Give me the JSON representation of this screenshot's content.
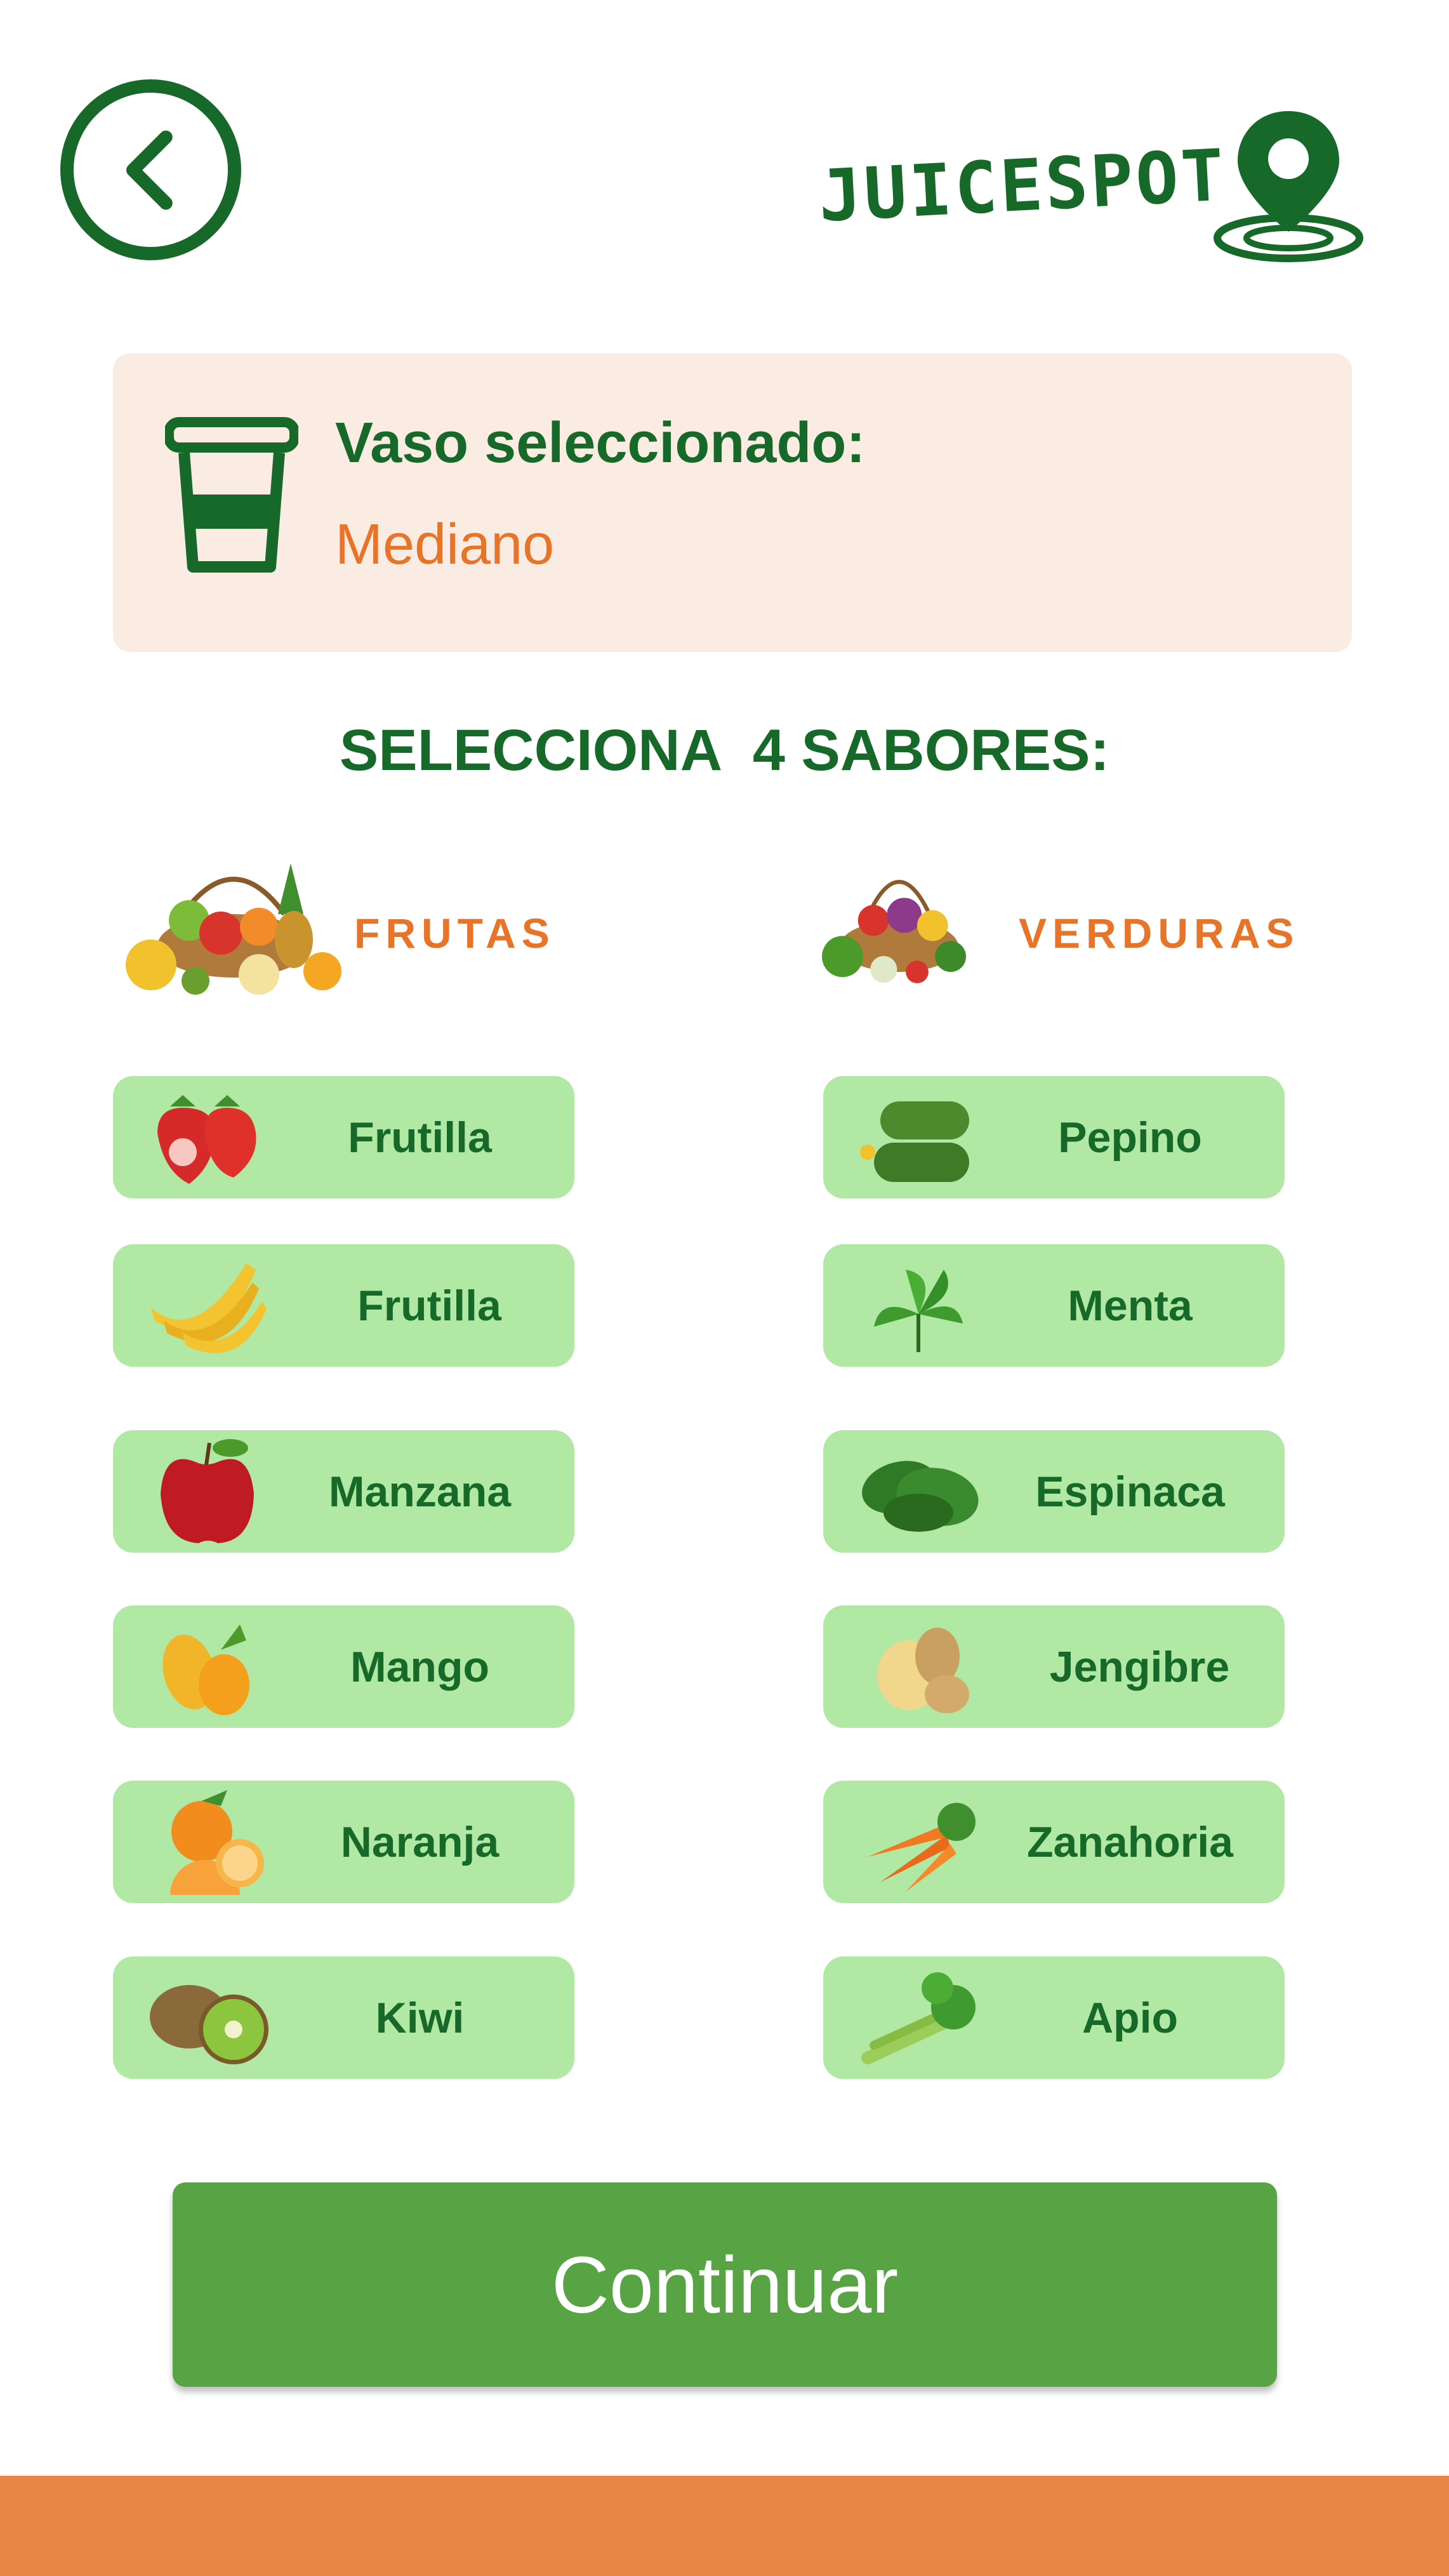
{
  "header": {
    "back_icon": "chevron-left-icon",
    "logo_text": "JUICESPOT",
    "logo_icon": "location-pin-icon"
  },
  "cup": {
    "icon": "cup-icon",
    "title": "Vaso seleccionado:",
    "value": "Mediano"
  },
  "section": {
    "heading": "SELECCIONA  4 SABORES:"
  },
  "categories": {
    "fruits": {
      "label": "FRUTAS",
      "icon": "fruit-basket-icon"
    },
    "veggies": {
      "label": "VERDURAS",
      "icon": "vegetable-basket-icon"
    }
  },
  "fruits": [
    {
      "label": "Frutilla",
      "icon": "strawberry-icon"
    },
    {
      "label": "Frutilla",
      "icon": "banana-icon"
    },
    {
      "label": "Manzana",
      "icon": "apple-icon"
    },
    {
      "label": "Mango",
      "icon": "mango-icon"
    },
    {
      "label": "Naranja",
      "icon": "orange-icon"
    },
    {
      "label": "Kiwi",
      "icon": "kiwi-icon"
    }
  ],
  "veggies": [
    {
      "label": "Pepino",
      "icon": "cucumber-icon"
    },
    {
      "label": "Menta",
      "icon": "mint-icon"
    },
    {
      "label": "Espinaca",
      "icon": "spinach-icon"
    },
    {
      "label": "Jengibre",
      "icon": "ginger-icon"
    },
    {
      "label": "Zanahoria",
      "icon": "carrot-icon"
    },
    {
      "label": "Apio",
      "icon": "celery-icon"
    }
  ],
  "actions": {
    "continue_label": "Continuar"
  },
  "colors": {
    "primary_green": "#17692a",
    "accent_orange": "#e8742a",
    "button_green": "#58a444",
    "chip_green": "#b0e8a4",
    "card_bg": "#fbece3",
    "footer_orange": "#e88645"
  }
}
